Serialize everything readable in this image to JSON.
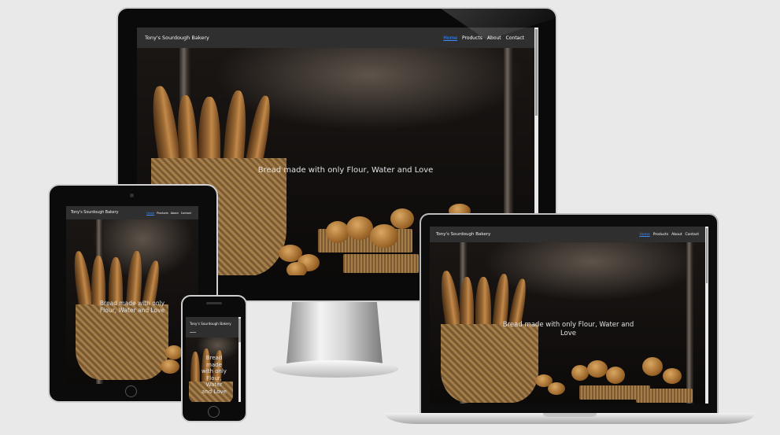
{
  "brand": "Tony's Sourdough Bakery",
  "nav_links": [
    "Home",
    "Products",
    "About",
    "Contact"
  ],
  "hero_tagline": "Bread made with only Flour, Water and Love",
  "accent_color": "#3d8bff",
  "nav_bg_color": "#2f2f2f",
  "devices": [
    "desktop-monitor",
    "laptop",
    "tablet",
    "phone"
  ]
}
